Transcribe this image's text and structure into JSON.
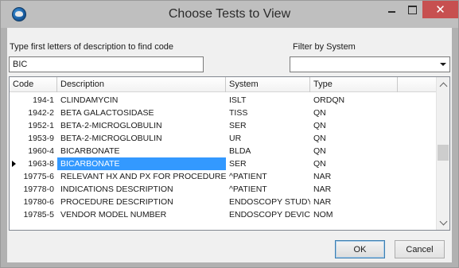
{
  "window": {
    "title": "Choose Tests to View",
    "icon": "app-globe-icon",
    "controls": {
      "minimize": "minimize-icon",
      "maximize": "maximize-icon",
      "close": "✕"
    }
  },
  "search": {
    "label": "Type first letters of description to find code",
    "value": "BIC"
  },
  "filter": {
    "label": "Filter by System",
    "value": ""
  },
  "grid": {
    "columns": [
      "Code",
      "Description",
      "System",
      "Type"
    ],
    "selected_row_index": 5,
    "rows": [
      {
        "code": "194-1",
        "description": "CLINDAMYCIN",
        "system": "ISLT",
        "type": "ORDQN"
      },
      {
        "code": "1942-2",
        "description": "BETA GALACTOSIDASE",
        "system": "TISS",
        "type": "QN"
      },
      {
        "code": "1952-1",
        "description": "BETA-2-MICROGLOBULIN",
        "system": "SER",
        "type": "QN"
      },
      {
        "code": "1953-9",
        "description": "BETA-2-MICROGLOBULIN",
        "system": "UR",
        "type": "QN"
      },
      {
        "code": "1960-4",
        "description": "BICARBONATE",
        "system": "BLDA",
        "type": "QN"
      },
      {
        "code": "1963-8",
        "description": "BICARBONATE",
        "system": "SER",
        "type": "QN"
      },
      {
        "code": "19775-6",
        "description": "RELEVANT HX AND PX FOR PROCEDURE",
        "system": "^PATIENT",
        "type": "NAR"
      },
      {
        "code": "19778-0",
        "description": "INDICATIONS DESCRIPTION",
        "system": "^PATIENT",
        "type": "NAR"
      },
      {
        "code": "19780-6",
        "description": "PROCEDURE DESCRIPTION",
        "system": "ENDOSCOPY STUDY",
        "type": "NAR"
      },
      {
        "code": "19785-5",
        "description": "VENDOR MODEL NUMBER",
        "system": "ENDOSCOPY DEVICE",
        "type": "NOM"
      }
    ]
  },
  "buttons": {
    "ok": "OK",
    "cancel": "Cancel"
  },
  "colors": {
    "selection": "#3399ff",
    "close_button": "#c75050",
    "dialog_background": "#f0f0f0"
  }
}
